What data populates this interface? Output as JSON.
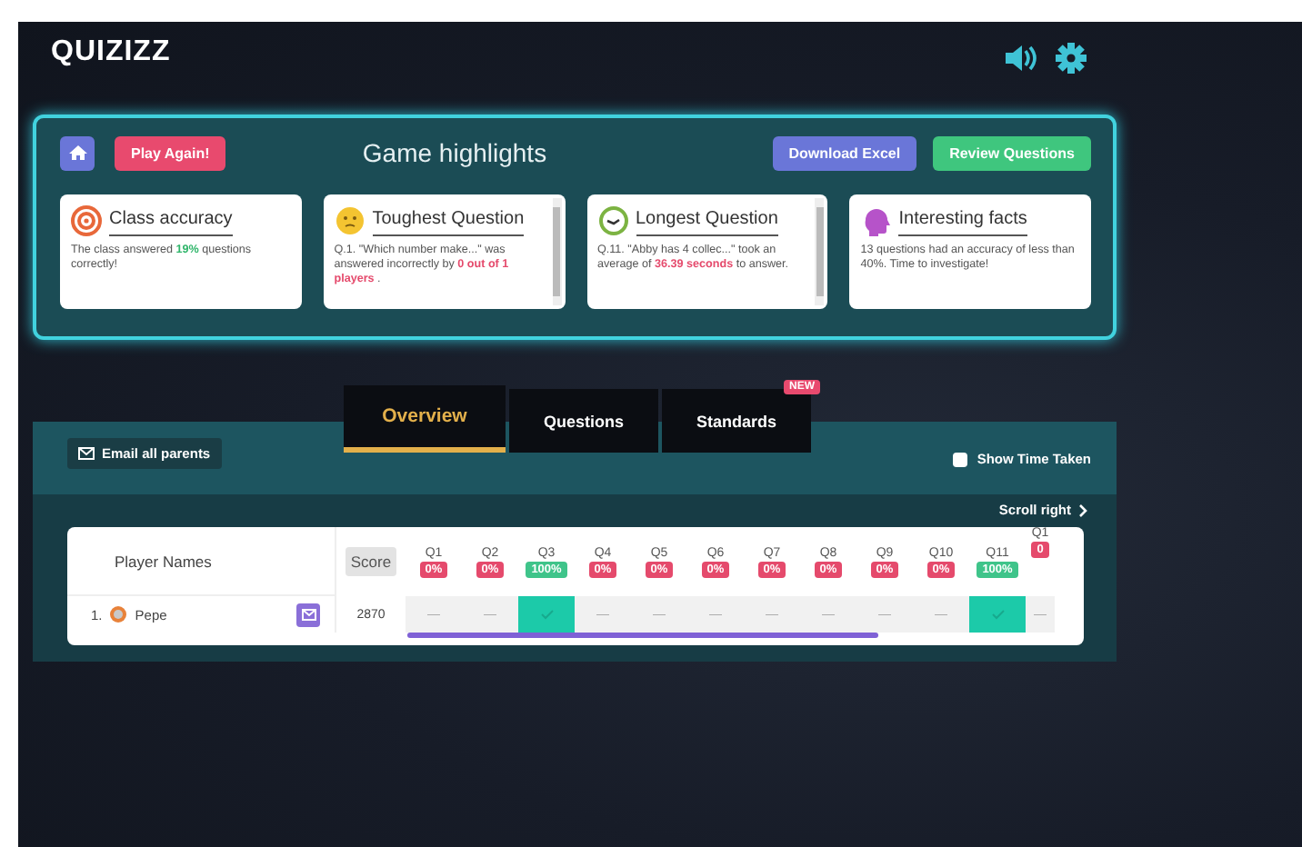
{
  "header": {
    "logo": "QUIZIZZ"
  },
  "highlights": {
    "title": "Game highlights",
    "buttons": [
      {
        "label": "Play Again!",
        "kind": "play"
      },
      {
        "label": "Download Excel",
        "kind": "download"
      },
      {
        "label": "Review Questions",
        "kind": "review"
      }
    ],
    "cards": [
      {
        "kind": "target",
        "title": "Class accuracy",
        "scrollable": false,
        "body": [
          {
            "text": "The class answered "
          },
          {
            "text": "19%",
            "color": "#2fb56a"
          },
          {
            "text": " questions correctly!"
          }
        ]
      },
      {
        "kind": "face",
        "title": "Toughest Question",
        "scrollable": true,
        "body": [
          {
            "text": "Q.1. \"Which number make...\" was answered incorrectly by "
          },
          {
            "text": "0 out of 1 players",
            "color": "#e54a6c"
          },
          {
            "text": " ."
          }
        ]
      },
      {
        "kind": "clock",
        "title": "Longest Question",
        "scrollable": true,
        "body": [
          {
            "text": "Q.11. \"Abby has 4 collec...\" took an average of "
          },
          {
            "text": "36.39 seconds",
            "color": "#e54a6c"
          },
          {
            "text": " to answer."
          }
        ]
      },
      {
        "kind": "head",
        "title": "Interesting facts",
        "scrollable": false,
        "body": [
          {
            "text": "13 questions had an accuracy of less than 40%. Time to investigate!"
          }
        ]
      }
    ]
  },
  "tabs": [
    {
      "label": "Overview",
      "selected": true
    },
    {
      "label": "Questions",
      "selected": false
    },
    {
      "label": "Standards",
      "selected": false,
      "badge": "NEW"
    }
  ],
  "toolbar": {
    "email_button": "Email all parents",
    "show_time_taken": {
      "label": "Show Time Taken",
      "checked": false
    },
    "scroll_right": "Scroll right"
  },
  "table": {
    "player_header": "Player Names",
    "score_header": "Score",
    "questions": [
      {
        "label": "Q1",
        "percent": "0%",
        "color": "#e54a6c"
      },
      {
        "label": "Q2",
        "percent": "0%",
        "color": "#e54a6c"
      },
      {
        "label": "Q3",
        "percent": "100%",
        "color": "#3fc48a"
      },
      {
        "label": "Q4",
        "percent": "0%",
        "color": "#e54a6c"
      },
      {
        "label": "Q5",
        "percent": "0%",
        "color": "#e54a6c"
      },
      {
        "label": "Q6",
        "percent": "0%",
        "color": "#e54a6c"
      },
      {
        "label": "Q7",
        "percent": "0%",
        "color": "#e54a6c"
      },
      {
        "label": "Q8",
        "percent": "0%",
        "color": "#e54a6c"
      },
      {
        "label": "Q9",
        "percent": "0%",
        "color": "#e54a6c"
      },
      {
        "label": "Q10",
        "percent": "0%",
        "color": "#e54a6c"
      },
      {
        "label": "Q11",
        "percent": "100%",
        "color": "#3fc48a"
      },
      {
        "label": "Q1",
        "percent": "0",
        "color": "#e54a6c"
      }
    ],
    "rows": [
      {
        "rank": "1.",
        "name": "Pepe",
        "score": "2870",
        "answers": [
          {
            "kind": "blank",
            "text": "—"
          },
          {
            "kind": "blank",
            "text": "—"
          },
          {
            "kind": "correct"
          },
          {
            "kind": "blank",
            "text": "—"
          },
          {
            "kind": "blank",
            "text": "—"
          },
          {
            "kind": "blank",
            "text": "—"
          },
          {
            "kind": "blank",
            "text": "—"
          },
          {
            "kind": "blank",
            "text": "—"
          },
          {
            "kind": "blank",
            "text": "—"
          },
          {
            "kind": "blank",
            "text": "—"
          },
          {
            "kind": "correct"
          },
          {
            "kind": "blank",
            "text": "—"
          }
        ]
      }
    ]
  }
}
